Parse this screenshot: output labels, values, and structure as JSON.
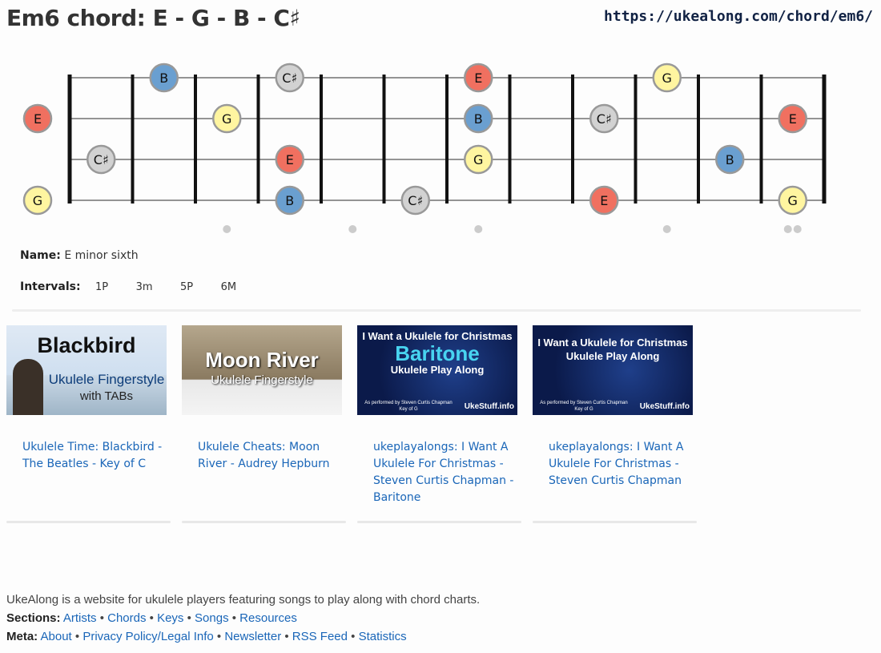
{
  "header": {
    "title": "Em6 chord: E - G - B - C♯",
    "url": "https://ukealong.com/chord/em6/"
  },
  "fretboard": {
    "strings": 4,
    "frets": 12,
    "string_order_top_to_bottom": [
      "A",
      "E",
      "C",
      "G"
    ],
    "note_colors": {
      "E": "#f07060",
      "G": "#fff5a0",
      "B": "#6a9fd0",
      "C♯": "#d2d2d2"
    },
    "notes": [
      {
        "string": 0,
        "fret": 2,
        "note": "B"
      },
      {
        "string": 0,
        "fret": 4,
        "note": "C♯"
      },
      {
        "string": 0,
        "fret": 7,
        "note": "E"
      },
      {
        "string": 0,
        "fret": 10,
        "note": "G"
      },
      {
        "string": 1,
        "fret": 0,
        "note": "E"
      },
      {
        "string": 1,
        "fret": 3,
        "note": "G"
      },
      {
        "string": 1,
        "fret": 7,
        "note": "B"
      },
      {
        "string": 1,
        "fret": 9,
        "note": "C♯"
      },
      {
        "string": 1,
        "fret": 12,
        "note": "E"
      },
      {
        "string": 2,
        "fret": 1,
        "note": "C♯"
      },
      {
        "string": 2,
        "fret": 4,
        "note": "E"
      },
      {
        "string": 2,
        "fret": 7,
        "note": "G"
      },
      {
        "string": 2,
        "fret": 11,
        "note": "B"
      },
      {
        "string": 3,
        "fret": 0,
        "note": "G"
      },
      {
        "string": 3,
        "fret": 4,
        "note": "B"
      },
      {
        "string": 3,
        "fret": 6,
        "note": "C♯"
      },
      {
        "string": 3,
        "fret": 9,
        "note": "E"
      },
      {
        "string": 3,
        "fret": 12,
        "note": "G"
      }
    ],
    "markers": [
      3,
      5,
      7,
      10,
      12
    ]
  },
  "info": {
    "name_label": "Name:",
    "name_value": "E minor sixth",
    "intervals_label": "Intervals:",
    "intervals": [
      "1P",
      "3m",
      "5P",
      "6M"
    ]
  },
  "videos": [
    {
      "title": "Ukulele Time: Blackbird - The Beatles - Key of C",
      "thumb": {
        "line1": "Blackbird",
        "line2": "Ukulele Fingerstyle",
        "line3": "with TABs"
      }
    },
    {
      "title": "Ukulele Cheats: Moon River - Audrey Hepburn",
      "thumb": {
        "line1": "Moon River",
        "line2": "Ukulele Fingerstyle"
      }
    },
    {
      "title": "ukeplayalongs: I Want A Ukulele For Christmas - Steven Curtis Chapman - Baritone",
      "thumb": {
        "line1": "I Want a Ukulele for Christmas",
        "line2": "Baritone",
        "line3": "Ukulele Play Along",
        "credit": "As performed by Steven Curtis Chapman",
        "key": "Key of G",
        "brand": "UkeStuff.info"
      }
    },
    {
      "title": "ukeplayalongs: I Want A Ukulele For Christmas - Steven Curtis Chapman",
      "thumb": {
        "line1": "I Want a Ukulele for Christmas",
        "line3": "Ukulele Play Along",
        "credit": "As performed by Steven Curtis Chapman",
        "key": "Key of G",
        "brand": "UkeStuff.info"
      }
    }
  ],
  "footer": {
    "tagline": "UkeAlong is a website for ukulele players featuring songs to play along with chord charts.",
    "sections_label": "Sections:",
    "sections": [
      "Artists",
      "Chords",
      "Keys",
      "Songs",
      "Resources"
    ],
    "meta_label": "Meta:",
    "meta": [
      "About",
      "Privacy Policy/Legal Info",
      "Newsletter",
      "RSS Feed",
      "Statistics"
    ]
  }
}
